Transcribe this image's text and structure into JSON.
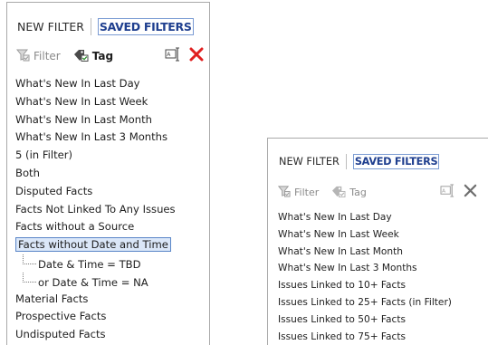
{
  "panel_left": {
    "tabs": {
      "new_filter": "NEW FILTER",
      "saved_filters": "SAVED FILTERS"
    },
    "toolbar": {
      "filter": "Filter",
      "tag": "Tag"
    },
    "items": [
      "What's New In Last Day",
      "What's New In Last Week",
      "What's New In Last Month",
      "What's New In Last 3 Months",
      "5 (in Filter)",
      "Both",
      "Disputed Facts",
      "Facts Not Linked To Any Issues",
      "Facts without a Source",
      "Facts without Date and Time",
      "Date & Time = TBD",
      "or Date & Time = NA",
      "Material Facts",
      "Prospective Facts",
      "Undisputed Facts"
    ],
    "selected_index": 9
  },
  "panel_right": {
    "tabs": {
      "new_filter": "NEW FILTER",
      "saved_filters": "SAVED FILTERS"
    },
    "toolbar": {
      "filter": "Filter",
      "tag": "Tag"
    },
    "items": [
      "What's New In Last Day",
      "What's New In Last Week",
      "What's New In Last Month",
      "What's New In Last 3 Months",
      "Issues Linked to 10+ Facts",
      "Issues Linked to 25+ Facts (in Filter)",
      "Issues Linked to 50+ Facts",
      "Issues Linked to 75+ Facts"
    ]
  },
  "colors": {
    "accent_tab": "#1f3f8f",
    "delete_active": "#e02020",
    "delete_disabled": "#6e6e6e",
    "selection_fill": "#dbe7f8",
    "selection_border": "#5a86c8"
  },
  "icons": {
    "filter": "funnel-check-icon",
    "tag": "tag-check-icon",
    "rename": "rename-field-icon",
    "delete": "x-delete-icon"
  }
}
